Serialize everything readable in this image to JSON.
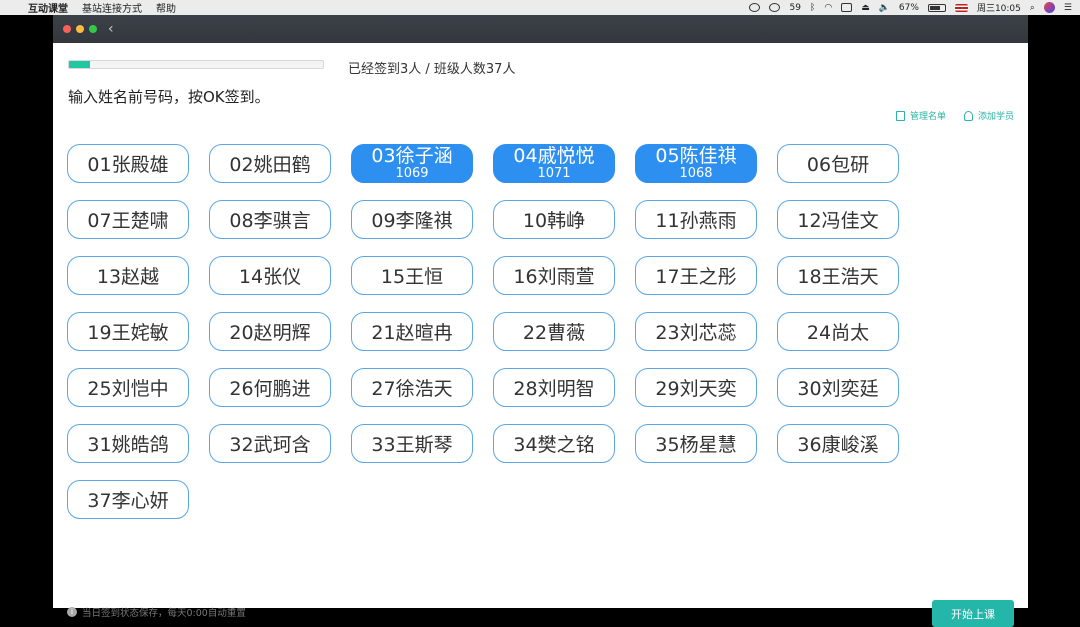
{
  "menubar": {
    "app_name": "互动课堂",
    "menus": [
      "基站连接方式",
      "帮助"
    ],
    "wechat_count": "59",
    "battery": "67%",
    "clock": "周三10:05"
  },
  "progress": {
    "fraction": 0.081
  },
  "header": {
    "signed_text": "已经签到3人 / 班级人数37人",
    "instruction": "输入姓名前号码，按OK签到。"
  },
  "links": {
    "manage": "管理名单",
    "add": "添加学员"
  },
  "students": [
    {
      "name": "01张殿雄"
    },
    {
      "name": "02姚田鹤"
    },
    {
      "name": "03徐子涵",
      "code": "1069",
      "checked": true
    },
    {
      "name": "04戚悦悦",
      "code": "1071",
      "checked": true
    },
    {
      "name": "05陈佳祺",
      "code": "1068",
      "checked": true
    },
    {
      "name": "06包研"
    },
    {
      "name": "07王楚啸"
    },
    {
      "name": "08李骐言"
    },
    {
      "name": "09李隆祺"
    },
    {
      "name": "10韩峥"
    },
    {
      "name": "11孙燕雨"
    },
    {
      "name": "12冯佳文"
    },
    {
      "name": "13赵越"
    },
    {
      "name": "14张仪"
    },
    {
      "name": "15王恒"
    },
    {
      "name": "16刘雨萱"
    },
    {
      "name": "17王之彤"
    },
    {
      "name": "18王浩天"
    },
    {
      "name": "19王姹敏"
    },
    {
      "name": "20赵明辉"
    },
    {
      "name": "21赵暄冉"
    },
    {
      "name": "22曹薇"
    },
    {
      "name": "23刘芯蕊"
    },
    {
      "name": "24尚太"
    },
    {
      "name": "25刘恺中"
    },
    {
      "name": "26何鹏进"
    },
    {
      "name": "27徐浩天"
    },
    {
      "name": "28刘明智"
    },
    {
      "name": "29刘天奕"
    },
    {
      "name": "30刘奕廷"
    },
    {
      "name": "31姚皓鸽"
    },
    {
      "name": "32武珂含"
    },
    {
      "name": "33王斯琴"
    },
    {
      "name": "34樊之铭"
    },
    {
      "name": "35杨星慧"
    },
    {
      "name": "36康峻溪"
    },
    {
      "name": "37李心妍"
    }
  ],
  "footer": {
    "note": "当日签到状态保存，每天0:00自动重置",
    "start_button": "开始上课"
  },
  "colors": {
    "accent": "#24b6a8",
    "checked": "#2d8ff0",
    "border": "#5aa7e2"
  }
}
